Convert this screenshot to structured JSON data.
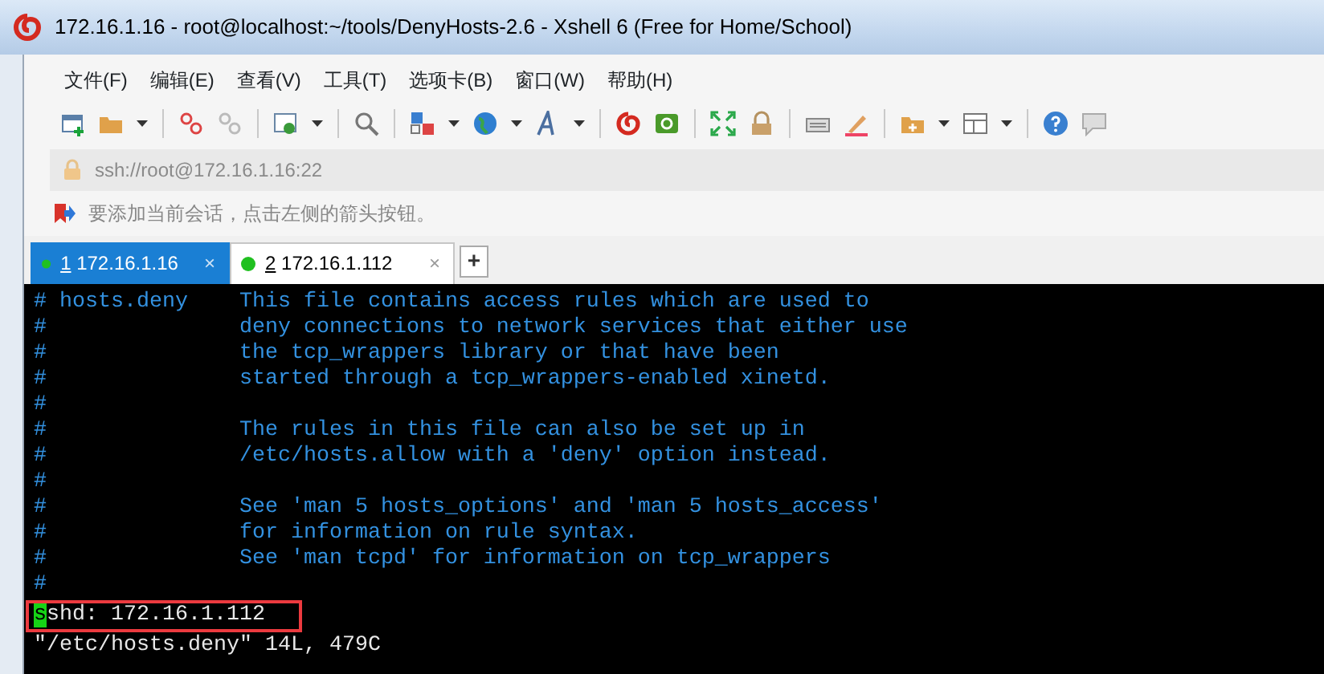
{
  "window": {
    "title": "172.16.1.16 - root@localhost:~/tools/DenyHosts-2.6 - Xshell 6 (Free for Home/School)"
  },
  "menu": [
    "文件(F)",
    "编辑(E)",
    "查看(V)",
    "工具(T)",
    "选项卡(B)",
    "窗口(W)",
    "帮助(H)"
  ],
  "address_bar": {
    "value": "ssh://root@172.16.1.16:22"
  },
  "session_hint": "要添加当前会话，点击左侧的箭头按钮。",
  "tabs": [
    {
      "number": "1",
      "label": "172.16.1.16",
      "selected": true,
      "connected": true,
      "close": "×"
    },
    {
      "number": "2",
      "label": "172.16.1.112",
      "selected": false,
      "connected": true,
      "close": "×"
    }
  ],
  "new_tab": "+",
  "terminal": {
    "lines": [
      {
        "kind": "comment",
        "text": "# hosts.deny    This file contains access rules which are used to"
      },
      {
        "kind": "comment",
        "text": "#               deny connections to network services that either use"
      },
      {
        "kind": "comment",
        "text": "#               the tcp_wrappers library or that have been"
      },
      {
        "kind": "comment",
        "text": "#               started through a tcp_wrappers-enabled xinetd."
      },
      {
        "kind": "comment",
        "text": "#"
      },
      {
        "kind": "comment",
        "text": "#               The rules in this file can also be set up in"
      },
      {
        "kind": "comment",
        "text": "#               /etc/hosts.allow with a 'deny' option instead."
      },
      {
        "kind": "comment",
        "text": "#"
      },
      {
        "kind": "comment",
        "text": "#               See 'man 5 hosts_options' and 'man 5 hosts_access'"
      },
      {
        "kind": "comment",
        "text": "#               for information on rule syntax."
      },
      {
        "kind": "comment",
        "text": "#               See 'man tcpd' for information on tcp_wrappers"
      },
      {
        "kind": "comment",
        "text": "#"
      },
      {
        "kind": "text",
        "text": "sshd: 172.16.1.112",
        "cursor": true
      },
      {
        "kind": "text",
        "text": "\"/etc/hosts.deny\" 14L, 479C"
      }
    ]
  }
}
